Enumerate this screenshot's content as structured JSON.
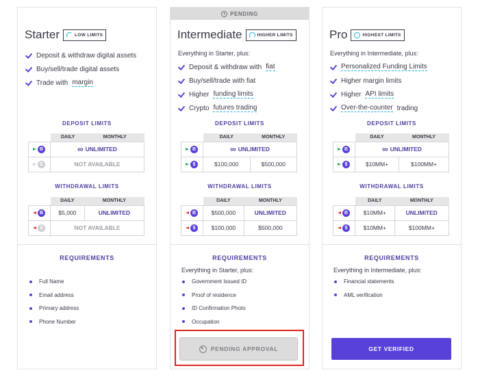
{
  "tiers": [
    {
      "name": "Starter",
      "badge": "LOW LIMITS",
      "features": [
        "Deposit & withdraw digital assets",
        "Buy/sell/trade digital assets",
        "Trade with"
      ],
      "feature_links": [
        "margin"
      ],
      "deposit_title": "DEPOSIT LIMITS",
      "withdraw_title": "WITHDRAWAL LIMITS",
      "deposit": {
        "crypto": "UNLIMITED",
        "fiat": "NOT AVAILABLE"
      },
      "withdraw": {
        "crypto_daily": "$5,000",
        "crypto_monthly": "UNLIMITED",
        "fiat": "NOT AVAILABLE"
      },
      "requirements_title": "REQUIREMENTS",
      "requirements": [
        "Full Name",
        "Email address",
        "Primary address",
        "Phone Number"
      ]
    },
    {
      "name": "Intermediate",
      "badge": "HIGHER LIMITS",
      "banner": "PENDING",
      "intro": "Everything in Starter, plus:",
      "features": [
        "Deposit & withdraw with",
        "Buy/sell/trade with fiat",
        "Higher",
        "Crypto"
      ],
      "feature_links": [
        "fiat",
        "funding limits",
        "futures trading"
      ],
      "deposit_title": "DEPOSIT LIMITS",
      "withdraw_title": "WITHDRAWAL LIMITS",
      "deposit": {
        "crypto": "UNLIMITED",
        "fiat_daily": "$100,000",
        "fiat_monthly": "$500,000"
      },
      "withdraw": {
        "crypto_daily": "$500,000",
        "crypto_monthly": "UNLIMITED",
        "fiat_daily": "$100,000",
        "fiat_monthly": "$500,000"
      },
      "requirements_title": "REQUIREMENTS",
      "requirements_intro": "Everything in Starter, plus:",
      "requirements": [
        "Government Issued ID",
        "Proof of residence",
        "ID Confirmation Photo",
        "Occupation"
      ],
      "button": "PENDING APPROVAL"
    },
    {
      "name": "Pro",
      "badge": "HIGHEST LIMITS",
      "intro": "Everything in Intermediate, plus:",
      "features": [
        "Higher margin limits",
        "Higher"
      ],
      "feature_links": [
        "Personalized Funding Limits",
        "API limits",
        "Over-the-counter"
      ],
      "feature_tail": "trading",
      "deposit_title": "DEPOSIT LIMITS",
      "withdraw_title": "WITHDRAWAL LIMITS",
      "deposit": {
        "crypto": "UNLIMITED",
        "fiat_daily": "$10MM+",
        "fiat_monthly": "$100MM+"
      },
      "withdraw": {
        "crypto_daily": "$10MM+",
        "crypto_monthly": "UNLIMITED",
        "fiat_daily": "$10MM+",
        "fiat_monthly": "$100MM+"
      },
      "requirements_title": "REQUIREMENTS",
      "requirements_intro": "Everything in Intermediate, plus:",
      "requirements": [
        "Financial statements",
        "AML verification"
      ],
      "button": "GET VERIFIED"
    }
  ],
  "table_headers": {
    "daily": "DAILY",
    "monthly": "MONTHLY"
  },
  "icons": {
    "crypto": "bitcoin-icon",
    "fiat": "dollar-icon",
    "badge": "ring-icon",
    "check": "check-icon",
    "clock": "clock-icon"
  },
  "colors": {
    "accent": "#5741d9",
    "badge_ring": "#1ab0e8",
    "deposit_arrow": "#22aa55",
    "withdraw_arrow": "#e23434",
    "highlight": "#e02020"
  }
}
